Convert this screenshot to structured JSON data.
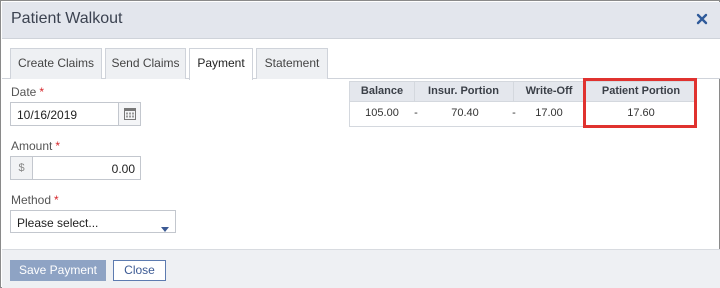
{
  "window": {
    "title": "Patient Walkout",
    "close_icon": "close-icon"
  },
  "tabs": [
    {
      "label": "Create Claims"
    },
    {
      "label": "Send Claims"
    },
    {
      "label": "Payment",
      "active": true
    },
    {
      "label": "Statement"
    }
  ],
  "form": {
    "date": {
      "label": "Date",
      "required_mark": "*",
      "value": "10/16/2019",
      "icon": "calendar-icon"
    },
    "amount": {
      "label": "Amount",
      "required_mark": "*",
      "prefix": "$",
      "value": "0.00"
    },
    "method": {
      "label": "Method",
      "required_mark": "*",
      "value": "Please select...",
      "icon": "dropdown-caret-icon"
    }
  },
  "summary": {
    "headers": [
      "Balance",
      "Insur. Portion",
      "Write-Off",
      "Patient Portion"
    ],
    "values": {
      "balance": "105.00",
      "insur_portion": "70.40",
      "write_off": "17.00",
      "patient_portion": "17.60"
    },
    "separators": [
      "-",
      "-",
      "="
    ]
  },
  "highlight": {
    "color": "#e0322f",
    "target": "Patient Portion"
  },
  "footer": {
    "save_label": "Save Payment",
    "close_label": "Close"
  },
  "colors": {
    "titlebar": "#e3e6ed",
    "save_button": "#8ea3c4",
    "close_button_border": "#5d7bb0",
    "required": "#d6262b"
  }
}
